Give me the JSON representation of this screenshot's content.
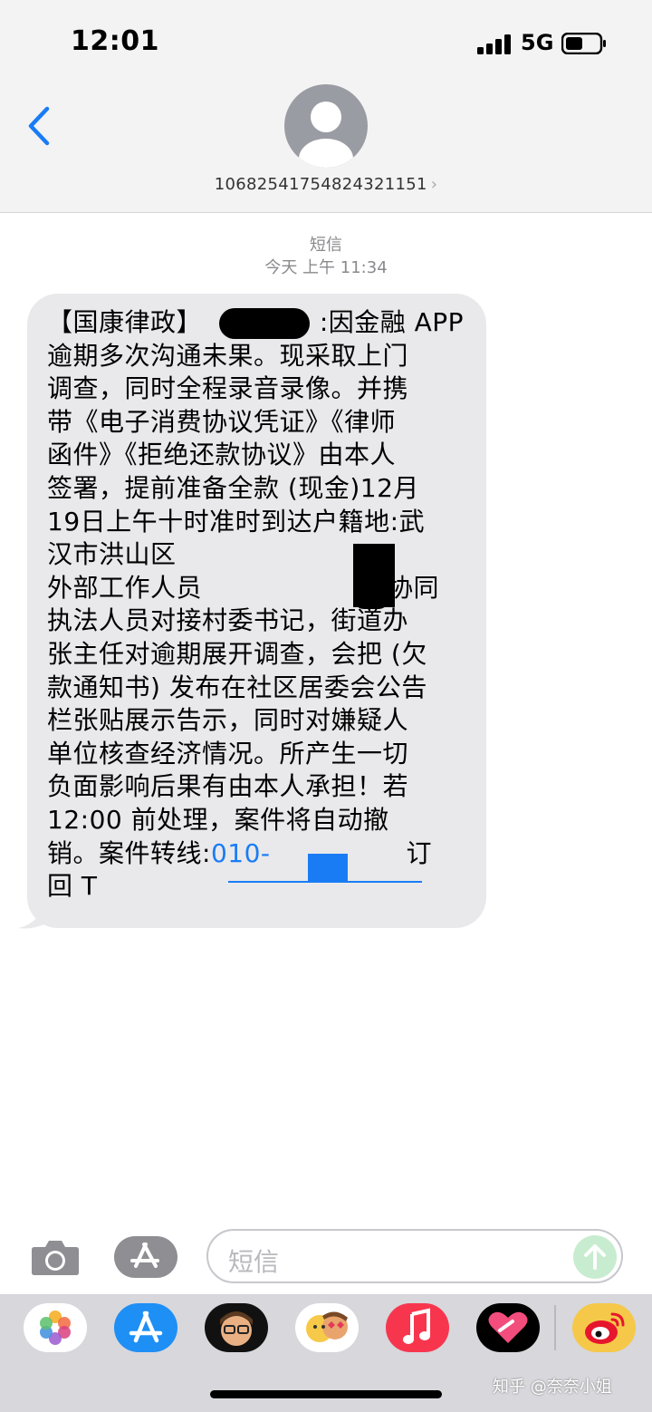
{
  "status_bar": {
    "time": "12:01",
    "network": "5G",
    "icons": [
      "signal-icon",
      "battery-icon"
    ]
  },
  "header": {
    "contact_number": "10682541754824321151",
    "chevron": "›",
    "icons": [
      "back-chevron-icon",
      "contact-avatar-icon"
    ]
  },
  "meta": {
    "channel": "短信",
    "timestamp": "今天 上午 11:34"
  },
  "message": {
    "text": "【国康律政】\t\t:因金融 APP\n逾期多次沟通未果。现采取上门\n调查，同时全程录音录像。并携\n带《电子消费协议凭证》《律师\n函件》《拒绝还款协议》由本人\n签署，提前准备全款 (现金)12月\n19日上午十时准时到达户籍地:武\n汉市洪山区\n外部工作人员\t\t\t协同\n执法人员对接村委书记，街道办\n张主任对逾期展开调查，会把 (欠\n款通知书) 发布在社区居委会公告\n栏张贴展示告示，同时对嫌疑人\n单位核查经济情况。所产生一切\n负面影响后果有由本人承担！若\n12:00 前处理，案件将自动撤\n销。案件转线:",
    "phone_link": "010-",
    "suffix": "订\n回 T",
    "bubble_color": "#e9e9eb",
    "link_color": "#1a7cf5"
  },
  "input_bar": {
    "placeholder": "短信",
    "icons": [
      "camera-icon",
      "app-store-icon",
      "send-arrow-icon"
    ]
  },
  "app_drawer": {
    "apps": [
      "photos-icon",
      "app-store-icon",
      "memoji-icon",
      "animoji-stickers-icon",
      "music-icon",
      "digital-touch-icon",
      "weibo-icon"
    ]
  },
  "watermark": "知乎 @奈奈小姐"
}
